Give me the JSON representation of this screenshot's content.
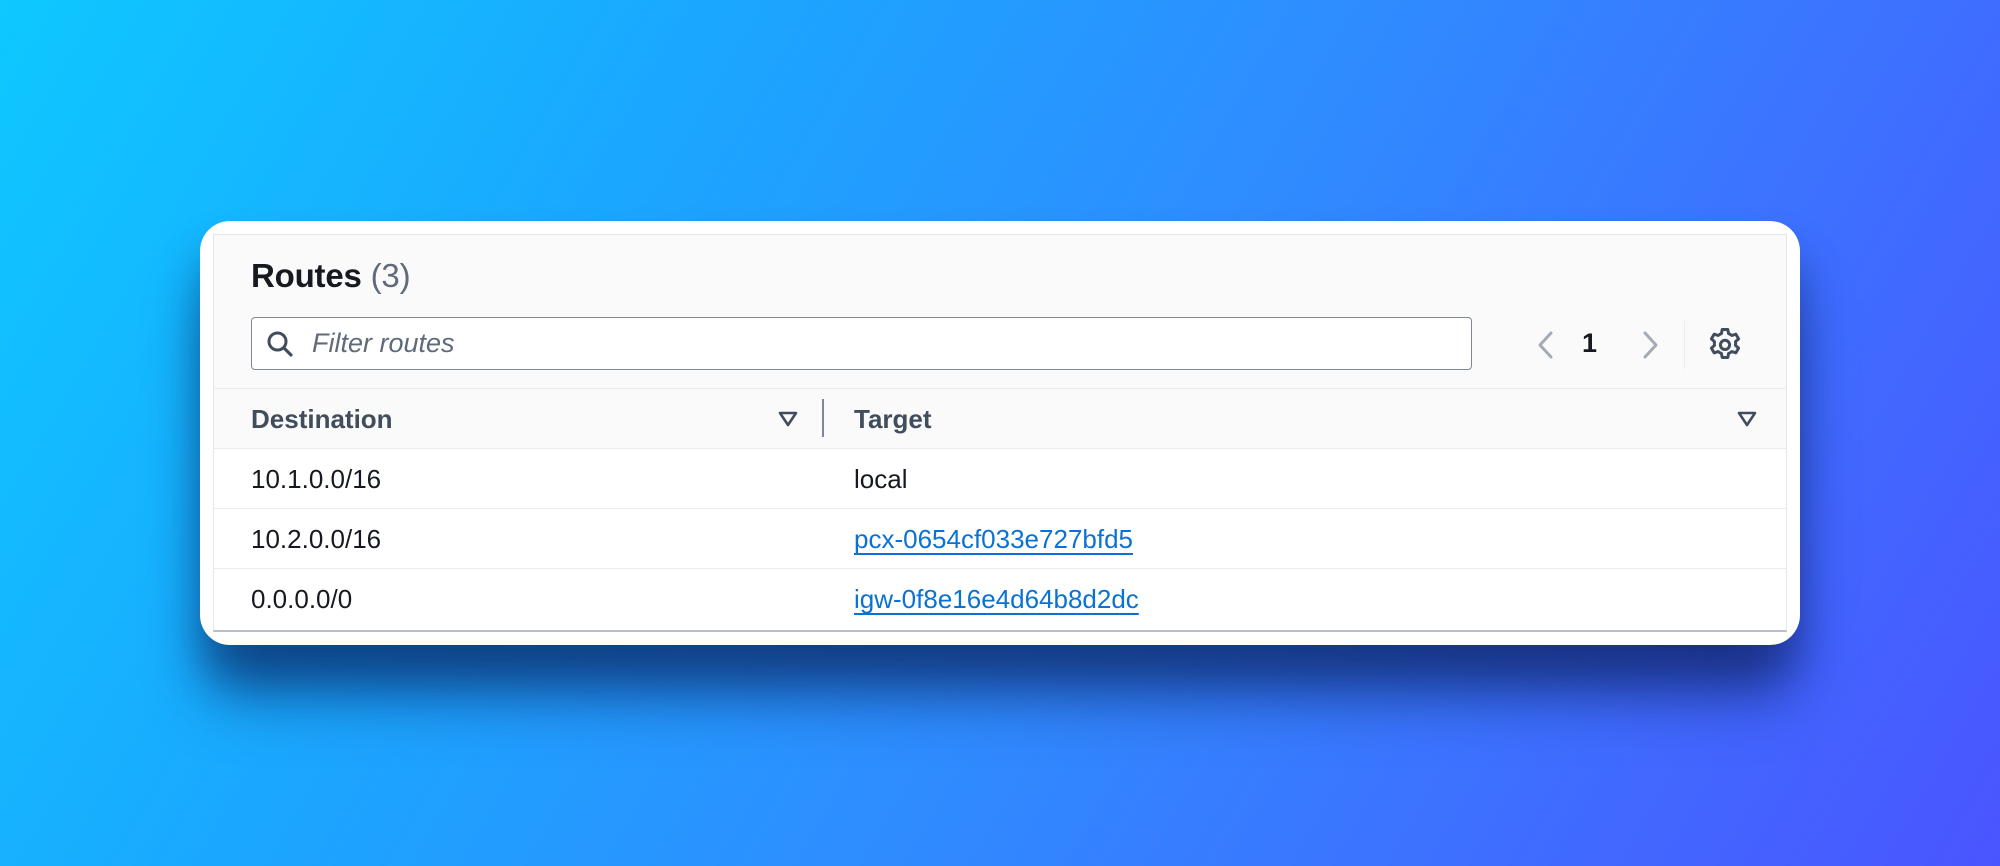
{
  "panel": {
    "title": "Routes",
    "count": "(3)"
  },
  "search": {
    "placeholder": "Filter routes",
    "value": ""
  },
  "pagination": {
    "current_page": "1"
  },
  "table": {
    "columns": [
      {
        "label": "Destination"
      },
      {
        "label": "Target"
      }
    ],
    "rows": [
      {
        "destination": "10.1.0.0/16",
        "target": "local",
        "target_is_link": false
      },
      {
        "destination": "10.2.0.0/16",
        "target": "pcx-0654cf033e727bfd5",
        "target_is_link": true
      },
      {
        "destination": "0.0.0.0/0",
        "target": "igw-0f8e16e4d64b8d2dc",
        "target_is_link": true
      }
    ]
  },
  "icons": {
    "search": "search-icon",
    "prev": "chevron-left-icon",
    "next": "chevron-right-icon",
    "settings": "gear-icon",
    "sort": "caret-down-icon"
  },
  "colors": {
    "link": "#0972d3",
    "text": "#16191f",
    "muted": "#5f6b7a",
    "header_bg": "#fafafa"
  }
}
